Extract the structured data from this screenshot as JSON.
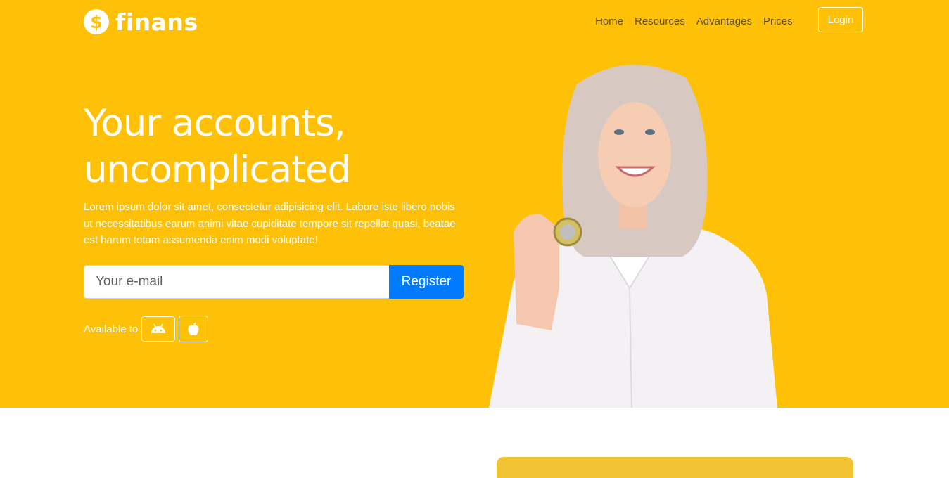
{
  "brand": {
    "name": "finans",
    "icon": "dollar-icon",
    "icon_glyph": "$"
  },
  "nav": {
    "items": [
      {
        "label": "Home"
      },
      {
        "label": "Resources"
      },
      {
        "label": "Advantages"
      },
      {
        "label": "Prices"
      }
    ],
    "login_label": "Login"
  },
  "hero": {
    "headline_line1": "Your accounts,",
    "headline_line2": "uncomplicated",
    "description": "Lorem ipsum dolor sit amet, consectetur adipisicing elit. Labore iste libero nobis ut necessitatibus earum animi vitae cupiditate tempore sit repellat quasi, beatae est harum totam assumenda enim modi voluptate!",
    "email_placeholder": "Your e-mail",
    "register_label": "Register",
    "available_label": "Available to",
    "stores": [
      "android-icon",
      "apple-icon"
    ]
  },
  "colors": {
    "hero_bg": "#ffc107",
    "register_bg": "#007bff",
    "nav_text": "#5e5030"
  }
}
